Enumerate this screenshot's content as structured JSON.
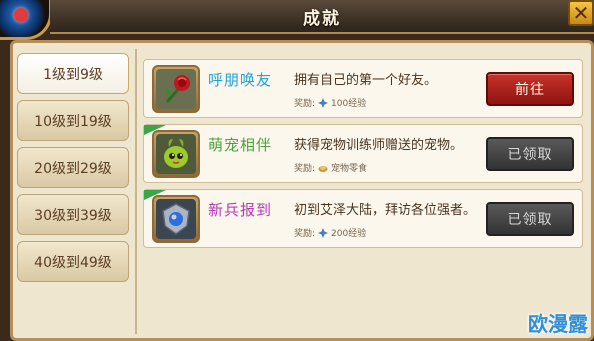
{
  "header": {
    "title": "成就",
    "close_glyph": "✕"
  },
  "sidebar": {
    "items": [
      {
        "label": "1级到9级",
        "active": true
      },
      {
        "label": "10级到19级",
        "active": false
      },
      {
        "label": "20级到29级",
        "active": false
      },
      {
        "label": "30级到39级",
        "active": false
      },
      {
        "label": "40级到49级",
        "active": false
      }
    ]
  },
  "achievements": [
    {
      "name": "呼朋唤友",
      "name_color": "cyan",
      "icon": "rose-icon",
      "description": "拥有自己的第一个好友。",
      "reward_label": "奖励:",
      "reward_text": "100经验",
      "reward_icon": "exp-icon",
      "button_label": "前往",
      "button_state": "go",
      "new_badge": false
    },
    {
      "name": "萌宠相伴",
      "name_color": "green",
      "icon": "pet-icon",
      "description": "获得宠物训练师赠送的宠物。",
      "reward_label": "奖励:",
      "reward_text": "宠物零食",
      "reward_icon": "snack-icon",
      "button_label": "已领取",
      "button_state": "done",
      "new_badge": true
    },
    {
      "name": "新兵报到",
      "name_color": "purple",
      "icon": "shield-orb-icon",
      "description": "初到艾泽大陆，拜访各位强者。",
      "reward_label": "奖励:",
      "reward_text": "200经验",
      "reward_icon": "exp-icon",
      "button_label": "已领取",
      "button_state": "done",
      "new_badge": true
    }
  ],
  "watermark": "欧漫露",
  "colors": {
    "go_button": "#b3231d",
    "done_button": "#3f3f3f",
    "panel_bg": "#efe6cf"
  }
}
